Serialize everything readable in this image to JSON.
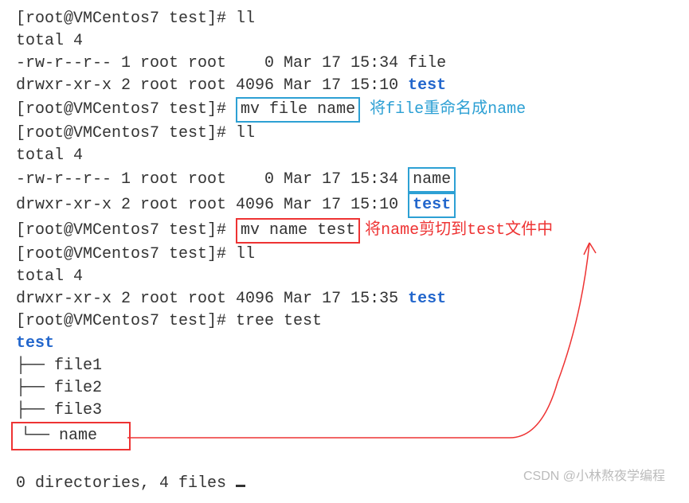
{
  "prompt1": "[root@VMCentos7 test]# ll",
  "total1": "total 4",
  "file_row1": "-rw-r--r-- 1 root root    0 Mar 17 15:34 file",
  "test_row1_prefix": "drwxr-xr-x 2 root root 4096 Mar 17 15:10 ",
  "test_label": "test",
  "prompt2_prefix": "[root@VMCentos7 test]# ",
  "mv_cmd1": "mv file name",
  "anno1": "将file重命名成name",
  "prompt3": "[root@VMCentos7 test]# ll",
  "total2": "total 4",
  "name_row_prefix": "-rw-r--r-- 1 root root    0 Mar 17 15:34 ",
  "name_label": "name",
  "test_row2_prefix": "drwxr-xr-x 2 root root 4096 Mar 17 15:10 ",
  "prompt4_prefix": "[root@VMCentos7 test]# ",
  "mv_cmd2": "mv name test",
  "anno2": "将name剪切到test文件中",
  "prompt5": "[root@VMCentos7 test]# ll",
  "total3": "total 4",
  "test_row3_prefix": "drwxr-xr-x 2 root root 4096 Mar 17 15:35 ",
  "prompt6": "[root@VMCentos7 test]# tree test",
  "tree_root": "test",
  "tree_f1": "├── file1",
  "tree_f2": "├── file2",
  "tree_f3": "├── file3",
  "tree_name": "└── name",
  "summary": "0 directories, 4 files ",
  "watermark": "CSDN @小林熬夜学编程"
}
